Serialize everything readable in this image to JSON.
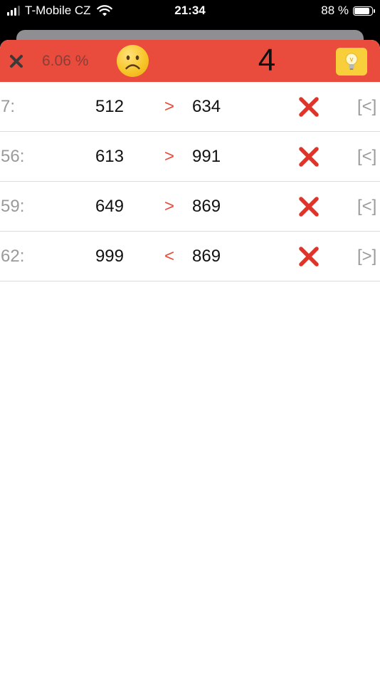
{
  "status_bar": {
    "carrier": "T-Mobile CZ",
    "time": "21:34",
    "battery": "88 %",
    "battery_level": 0.88
  },
  "header": {
    "close_icon": "close-icon",
    "percent": "6.06 %",
    "mood_icon": "frowning-face-icon",
    "score": "4",
    "hint_icon": "lightbulb-icon",
    "colors": {
      "header_bg": "#e94b3c",
      "hint_bg": "#f8cf3a"
    }
  },
  "rows": [
    {
      "index": "7:",
      "a": "512",
      "op": ">",
      "b": "634",
      "mark": "wrong-x-icon",
      "suggestion": "[<]"
    },
    {
      "index": "56:",
      "a": "613",
      "op": ">",
      "b": "991",
      "mark": "wrong-x-icon",
      "suggestion": "[<]"
    },
    {
      "index": "59:",
      "a": "649",
      "op": ">",
      "b": "869",
      "mark": "wrong-x-icon",
      "suggestion": "[<]"
    },
    {
      "index": "62:",
      "a": "999",
      "op": "<",
      "b": "869",
      "mark": "wrong-x-icon",
      "suggestion": "[>]"
    }
  ]
}
